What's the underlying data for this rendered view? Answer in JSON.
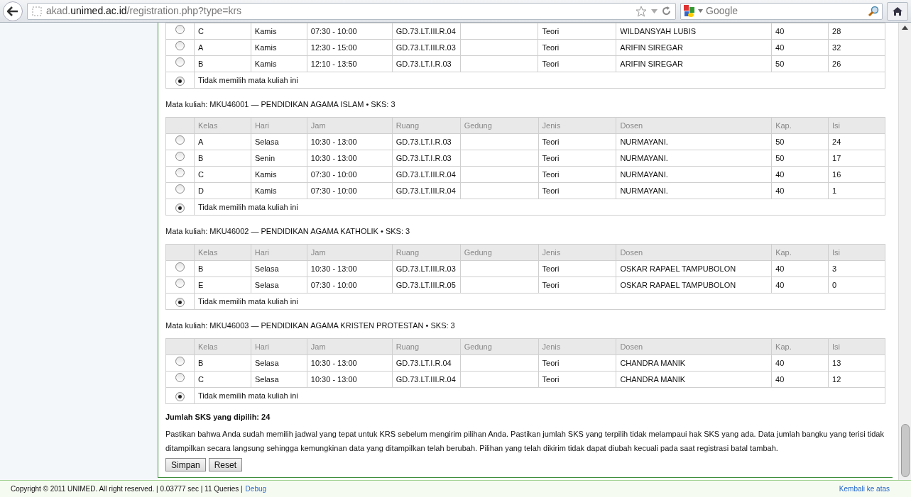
{
  "browser": {
    "url": {
      "prefix": "akad.",
      "domain": "unimed.ac.id",
      "path": "/registration.php?type=krs"
    },
    "search": {
      "placeholder": "Google"
    }
  },
  "top_table": {
    "rows": [
      {
        "cells": [
          "C",
          "Kamis",
          "07:30 - 10:00",
          "GD.73.LT.III.R.04",
          "",
          "Teori",
          "WILDANSYAH LUBIS",
          "40",
          "28"
        ],
        "selected": false
      },
      {
        "cells": [
          "A",
          "Kamis",
          "12:30 - 15:00",
          "GD.73.LT.III.R.03",
          "",
          "Teori",
          "ARIFIN SIREGAR",
          "40",
          "32"
        ],
        "selected": false
      },
      {
        "cells": [
          "B",
          "Kamis",
          "12:10 - 13:50",
          "GD.73.LT.I.R.03",
          "",
          "Teori",
          "ARIFIN SIREGAR",
          "50",
          "26"
        ],
        "selected": false
      }
    ],
    "none_option": {
      "label": "Tidak memilih mata kuliah ini",
      "selected": true
    }
  },
  "courses": [
    {
      "heading": "Mata kuliah: MKU46001 — PENDIDIKAN AGAMA ISLAM • SKS: 3",
      "columns": [
        "Kelas",
        "Hari",
        "Jam",
        "Ruang",
        "Gedung",
        "Jenis",
        "Dosen",
        "Kap.",
        "Isi"
      ],
      "rows": [
        {
          "cells": [
            "A",
            "Selasa",
            "10:30 - 13:00",
            "GD.73.LT.I.R.03",
            "",
            "Teori",
            "NURMAYANI.",
            "50",
            "24"
          ],
          "selected": false
        },
        {
          "cells": [
            "B",
            "Senin",
            "10:30 - 13:00",
            "GD.73.LT.I.R.03",
            "",
            "Teori",
            "NURMAYANI.",
            "50",
            "17"
          ],
          "selected": false
        },
        {
          "cells": [
            "C",
            "Kamis",
            "07:30 - 10:00",
            "GD.73.LT.III.R.04",
            "",
            "Teori",
            "NURMAYANI.",
            "40",
            "16"
          ],
          "selected": false
        },
        {
          "cells": [
            "D",
            "Kamis",
            "07:30 - 10:00",
            "GD.73.LT.III.R.04",
            "",
            "Teori",
            "NURMAYANI.",
            "40",
            "1"
          ],
          "selected": false
        }
      ],
      "none_option": {
        "label": "Tidak memilih mata kuliah ini",
        "selected": true
      }
    },
    {
      "heading": "Mata kuliah: MKU46002 — PENDIDIKAN AGAMA KATHOLIK • SKS: 3",
      "columns": [
        "Kelas",
        "Hari",
        "Jam",
        "Ruang",
        "Gedung",
        "Jenis",
        "Dosen",
        "Kap.",
        "Isi"
      ],
      "rows": [
        {
          "cells": [
            "B",
            "Selasa",
            "10:30 - 13:00",
            "GD.73.LT.III.R.03",
            "",
            "Teori",
            "OSKAR RAPAEL TAMPUBOLON",
            "40",
            "3"
          ],
          "selected": false
        },
        {
          "cells": [
            "E",
            "Selasa",
            "07:30 - 10:00",
            "GD.73.LT.III.R.05",
            "",
            "Teori",
            "OSKAR RAPAEL TAMPUBOLON",
            "40",
            "0"
          ],
          "selected": false
        }
      ],
      "none_option": {
        "label": "Tidak memilih mata kuliah ini",
        "selected": true
      }
    },
    {
      "heading": "Mata kuliah: MKU46003 — PENDIDIKAN AGAMA KRISTEN PROTESTAN • SKS: 3",
      "columns": [
        "Kelas",
        "Hari",
        "Jam",
        "Ruang",
        "Gedung",
        "Jenis",
        "Dosen",
        "Kap.",
        "Isi"
      ],
      "rows": [
        {
          "cells": [
            "B",
            "Selasa",
            "10:30 - 13:00",
            "GD.73.LT.I.R.04",
            "",
            "Teori",
            "CHANDRA MANIK",
            "40",
            "13"
          ],
          "selected": false
        },
        {
          "cells": [
            "C",
            "Selasa",
            "10:30 - 13:00",
            "GD.73.LT.III.R.04",
            "",
            "Teori",
            "CHANDRA MANIK",
            "40",
            "12"
          ],
          "selected": false
        }
      ],
      "none_option": {
        "label": "Tidak memilih mata kuliah ini",
        "selected": true
      }
    }
  ],
  "total": "Jumlah SKS yang dipilih: 24",
  "notice": "Pastikan bahwa Anda sudah memilih jadwal yang tepat untuk KRS sebelum mengirim pilihan Anda. Pastikan jumlah SKS yang terpilih tidak melampaui hak SKS yang ada. Data jumlah bangku yang terisi tidak ditampilkan secara langsung sehingga kemungkinan data yang ditampilkan telah berubah. Pilihan yang telah dikirim tidak dapat diubah kecuali pada saat registrasi batal tambah.",
  "buttons": [
    "Simpan",
    "Reset"
  ],
  "footer": {
    "text": "Copyright © 2011 UNIMED. All right reserved. | 0.03777 sec | 11 Queries |",
    "debug_link": "Debug",
    "top_link": "Kembali ke atas"
  }
}
